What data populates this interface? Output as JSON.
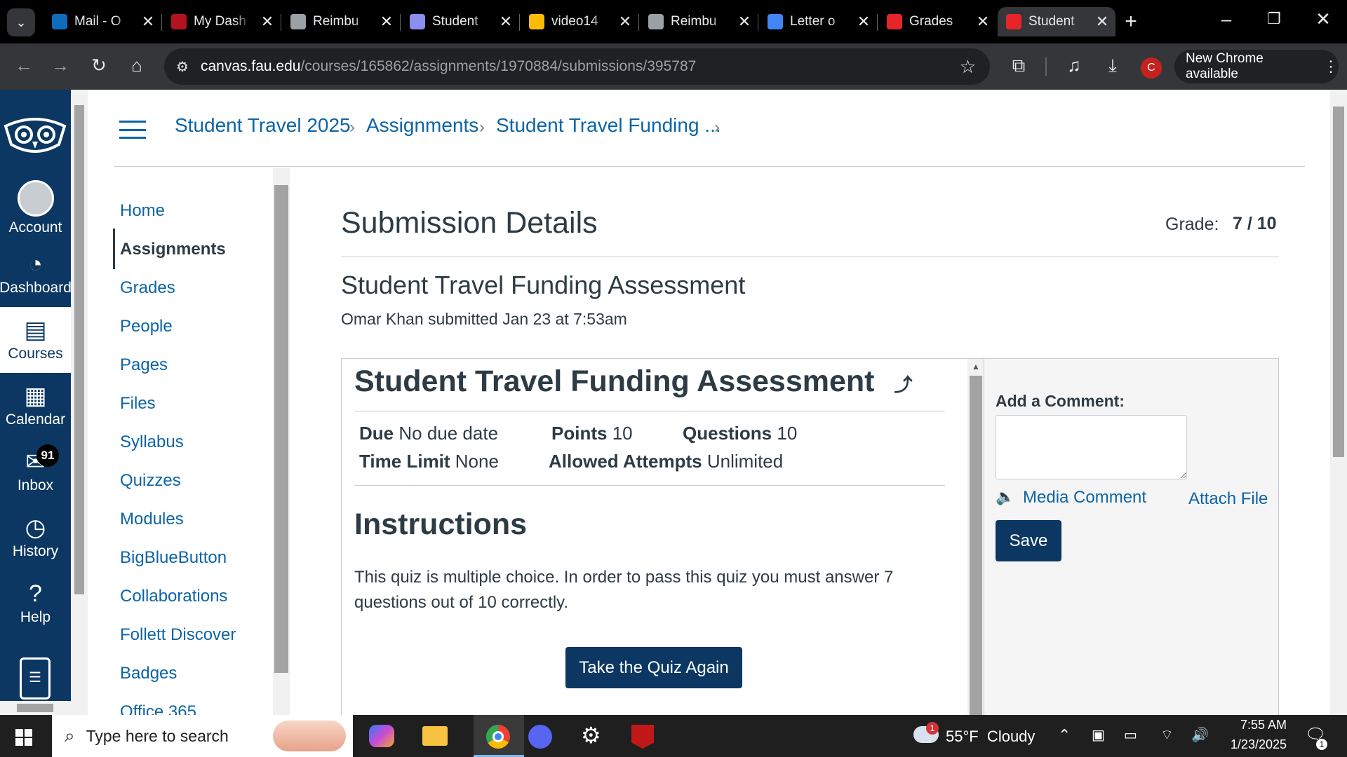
{
  "browser": {
    "tabs": [
      {
        "title": "Mail - O",
        "icon": "outlook-icon",
        "color": "#0f6cbd"
      },
      {
        "title": "My Dash",
        "icon": "myfau-icon",
        "color": "#b3121f"
      },
      {
        "title": "Reimbu",
        "icon": "globe-icon",
        "color": "#9aa0a6"
      },
      {
        "title": "Student",
        "icon": "canvas-icon",
        "color": "#8a8ff0"
      },
      {
        "title": "video14",
        "icon": "drive-icon",
        "color": "#fbbc04"
      },
      {
        "title": "Reimbu",
        "icon": "globe-icon",
        "color": "#9aa0a6"
      },
      {
        "title": "Letter o",
        "icon": "docs-icon",
        "color": "#4285f4"
      },
      {
        "title": "Grades",
        "icon": "canvas-icon",
        "color": "#e72429"
      },
      {
        "title": "Student",
        "icon": "canvas-icon",
        "color": "#e72429"
      }
    ],
    "url_host": "canvas.fau.edu",
    "url_path": "/courses/165862/assignments/1970884/submissions/395787",
    "profile_initial": "C",
    "update_label": "New Chrome available"
  },
  "global_nav": {
    "items": [
      {
        "label": "Account",
        "icon": "account-icon"
      },
      {
        "label": "Dashboard",
        "icon": "dashboard-icon"
      },
      {
        "label": "Courses",
        "icon": "courses-icon"
      },
      {
        "label": "Calendar",
        "icon": "calendar-icon"
      },
      {
        "label": "Inbox",
        "icon": "inbox-icon",
        "badge": "91"
      },
      {
        "label": "History",
        "icon": "history-icon"
      },
      {
        "label": "Help",
        "icon": "help-icon"
      }
    ]
  },
  "breadcrumbs": [
    "Student Travel 2025",
    "Assignments",
    "Student Travel Funding ..."
  ],
  "course_nav": [
    "Home",
    "Assignments",
    "Grades",
    "People",
    "Pages",
    "Files",
    "Syllabus",
    "Quizzes",
    "Modules",
    "BigBlueButton",
    "Collaborations",
    "Follett Discover",
    "Badges",
    "Office 365"
  ],
  "submission": {
    "heading": "Submission Details",
    "grade_label": "Grade:",
    "grade_value": "7 / 10",
    "assignment_title": "Student Travel Funding Assessment",
    "submitted_text": "Omar Khan submitted Jan 23 at 7:53am"
  },
  "quiz": {
    "title": "Student Travel Funding Assessment",
    "due_label": "Due",
    "due_value": "No due date",
    "points_label": "Points",
    "points_value": "10",
    "questions_label": "Questions",
    "questions_value": "10",
    "time_label": "Time Limit",
    "time_value": "None",
    "attempts_label": "Allowed Attempts",
    "attempts_value": "Unlimited",
    "instructions_heading": "Instructions",
    "instructions_text": "This quiz is multiple choice.  In order to pass this quiz you must answer 7 questions out of 10 correctly.",
    "retake_label": "Take the Quiz Again"
  },
  "comments": {
    "label": "Add a Comment:",
    "media_label": "Media Comment",
    "attach_label": "Attach File",
    "save_label": "Save"
  },
  "taskbar": {
    "search_placeholder": "Type here to search",
    "weather": "55°F  Cloudy",
    "weather_badge": "1",
    "time": "7:55 AM",
    "date": "1/23/2025",
    "notif_count": "1"
  }
}
